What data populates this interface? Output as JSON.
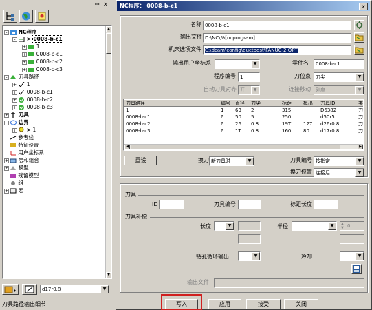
{
  "left_panel": {
    "tree": [
      {
        "label": "NC程序",
        "bold": true
      },
      {
        "label": "0008-b-c1",
        "bold": true,
        "arrow": ">"
      },
      {
        "label": "1"
      },
      {
        "label": "0008-b-c1"
      },
      {
        "label": "0008-b-c2"
      },
      {
        "label": "0008-b-c3"
      },
      {
        "label": "刀具路径",
        "bold": false
      },
      {
        "label": "1"
      },
      {
        "label": "0008-b-c1"
      },
      {
        "label": "0008-b-c2"
      },
      {
        "label": "0008-b-c3"
      },
      {
        "label": "刀具",
        "bold": true
      },
      {
        "label": "边界",
        "bold": true
      },
      {
        "label": "1",
        "arrow": ">"
      },
      {
        "label": "参考线"
      },
      {
        "label": "特征设置"
      },
      {
        "label": "用户坐标系"
      },
      {
        "label": "层和组合"
      },
      {
        "label": "模型"
      },
      {
        "label": "残留模型"
      },
      {
        "label": "组"
      },
      {
        "label": "宏"
      }
    ],
    "tool_selector_value": "d17r0.8",
    "status_text": "刀具路径输出细节"
  },
  "dialog": {
    "title": "NC程序：    0008-b-c1",
    "close_label": "x",
    "name_label": "名称",
    "name_value": "0008-b-c1",
    "output_file_label": "输出文件",
    "output_file_value": "D:\\NC\\%[ncprogram]",
    "machine_option_label": "机床选项文件",
    "machine_option_value": "C:\\dcam\\config\\ductpost\\FANUC-2.OPT",
    "output_ucs_label": "输出用户坐标系",
    "output_ucs_value": "",
    "part_name_label": "零件名",
    "part_name_value": "0008-b-c1",
    "program_number_label": "程序编号",
    "program_number_value": "1",
    "tool_point_label": "刀位点",
    "tool_point_value": "刀尖",
    "auto_tool_align_label": "自动刀具对齐",
    "auto_tool_align_value": "开",
    "link_move_label": "连接移动",
    "link_move_value": "刚度",
    "table_columns": [
      "刀具路径",
      "编号",
      "直径",
      "刀尖",
      "标距",
      "概出",
      "刀具ID",
      "类"
    ],
    "table_rows": [
      [
        "1",
        "1",
        "63",
        "2",
        "315",
        "",
        "D6382",
        "刀"
      ],
      [
        "0008-b-c1",
        "?",
        "50",
        "5",
        "250",
        "",
        "d50r5",
        "刀"
      ],
      [
        "0008-b-c2",
        "?",
        "26",
        "0.8",
        "19T",
        "127",
        "d26r0.8",
        "刀"
      ],
      [
        "0008-b-c3",
        "?",
        "1T",
        "0.8",
        "160",
        "80",
        "d17r0.8",
        "刀"
      ]
    ],
    "reset_label": "重设",
    "tool_change_label": "换刀",
    "tool_change_value": "新刀具时",
    "tool_number_label": "刀具编号",
    "tool_number_value": "按指定",
    "tool_change_pos_label": "换刀位置",
    "tool_change_pos_value": "连接后",
    "tool_group_label": "刀具",
    "id_label": "ID",
    "tool_no_label": "刀具编号",
    "gauge_length_label": "标距长度",
    "comp_group_label": "刀具补偿",
    "length_label": "长度",
    "radius_label": "半径",
    "radius_disabled_value": "0",
    "drill_cycle_label": "钻孔循环输出",
    "coolant_label": "冷却",
    "output_file2_label": "输出文件",
    "write_label": "写入",
    "apply_label": "应用",
    "accept_label": "接受",
    "close_button_label": "关闭"
  }
}
